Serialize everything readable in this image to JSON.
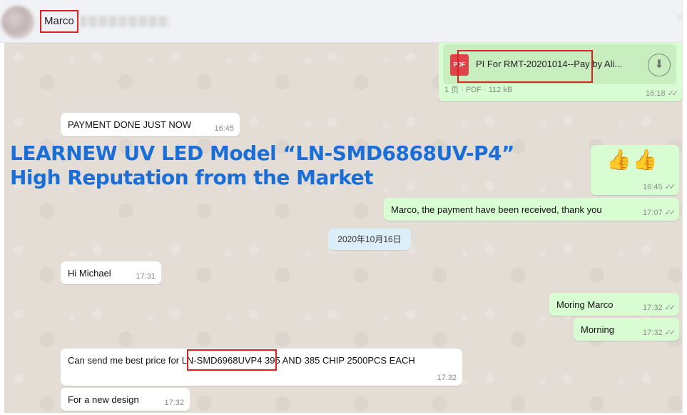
{
  "header": {
    "contact_name": "Marco"
  },
  "file_message": {
    "file_icon_label": "PDF",
    "file_name": "PI For RMT-20201014--Pay by Ali...",
    "meta": "1 页 · PDF · 112 kB",
    "time": "16:18",
    "ticks": "✓✓",
    "download_icon": "⬇"
  },
  "overlay": {
    "headline_line1": "LEARNEW UV LED Model “LN-SMD6868UV-P4”",
    "headline_line2": "High Reputation from the Market"
  },
  "messages": [
    {
      "text": "PAYMENT DONE JUST NOW",
      "time": "16:45"
    },
    {
      "text": "👍👍",
      "time": "16:45",
      "ticks": "✓✓"
    },
    {
      "text": "Marco, the payment have been received, thank you",
      "time": "17:07",
      "ticks": "✓✓"
    },
    {
      "text": "Hi Michael",
      "time": "17:31"
    },
    {
      "text": "Moring Marco",
      "time": "17:32",
      "ticks": "✓✓"
    },
    {
      "text": "Morning",
      "time": "17:32",
      "ticks": "✓✓"
    },
    {
      "text_before": "Can send me best price for ",
      "highlight": "LN-SMD6968UVP4",
      "text_after": " 395 AND 385 CHIP 2500PCS EACH",
      "time": "17:32"
    },
    {
      "text": "For a new design",
      "time": "17:32"
    }
  ],
  "date_separator": "2020年10月16日",
  "colors": {
    "incoming_bubble": "#ffffff",
    "outgoing_bubble": "#d9fdd3",
    "chat_background": "#e4ddd6",
    "headline": "#1a6ed8",
    "highlight_box": "#e02020"
  }
}
